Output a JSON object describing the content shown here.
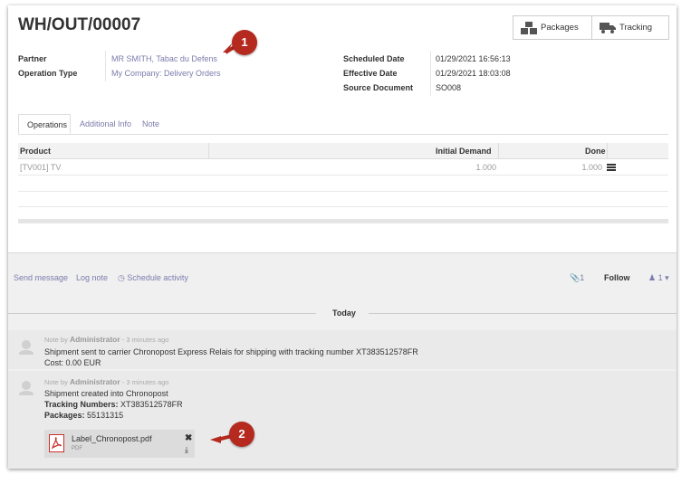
{
  "record": {
    "title": "WH/OUT/00007",
    "buttons": {
      "packages": "Packages",
      "tracking": "Tracking"
    },
    "left_fields": [
      {
        "label": "Partner",
        "value": "MR SMITH, Tabac du Defens"
      },
      {
        "label": "Operation Type",
        "value": "My Company: Delivery Orders"
      }
    ],
    "right_fields": [
      {
        "label": "Scheduled Date",
        "value": "01/29/2021 16:56:13"
      },
      {
        "label": "Effective Date",
        "value": "01/29/2021 18:03:08"
      },
      {
        "label": "Source Document",
        "value": "SO008"
      }
    ]
  },
  "tabs": [
    "Operations",
    "Additional Info",
    "Note"
  ],
  "table": {
    "columns": [
      "Product",
      "Initial Demand",
      "Done"
    ],
    "rows": [
      {
        "product": "[TV001] TV",
        "initial_demand": "1.000",
        "done": "1.000"
      }
    ]
  },
  "chatter": {
    "send_message": "Send message",
    "log_note": "Log note",
    "schedule_activity": "Schedule activity",
    "attachments_count": "1",
    "follow": "Follow",
    "followers_count": "1",
    "separator": "Today",
    "messages": [
      {
        "prefix": "Note by",
        "author": "Administrator",
        "time": "- 3 minutes ago",
        "line1": "Shipment sent to carrier Chronopost Express Relais for shipping with tracking number XT383512578FR",
        "line2": "Cost: 0.00 EUR"
      },
      {
        "prefix": "Note by",
        "author": "Administrator",
        "time": "- 3 minutes ago",
        "line1": "Shipment created into Chronopost",
        "tracking_label": "Tracking Numbers:",
        "tracking_value": "XT383512578FR",
        "packages_label": "Packages:",
        "packages_value": "55131315",
        "attachment": {
          "name": "Label_Chronopost.pdf",
          "type": "PDF"
        }
      }
    ]
  },
  "annotations": [
    "1",
    "2"
  ],
  "colors": {
    "link": "#7c7bad",
    "badge": "#b5291f",
    "pdf_red": "#c9302c"
  }
}
